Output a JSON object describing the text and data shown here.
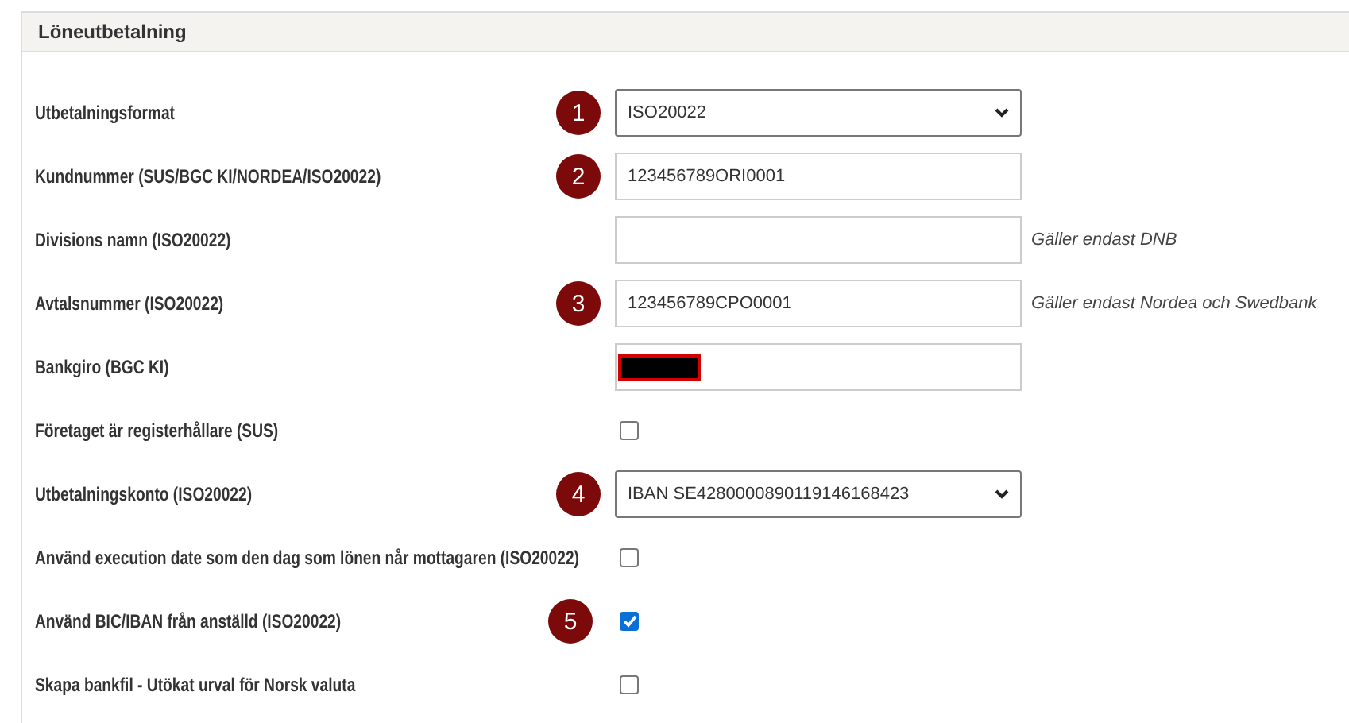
{
  "panel": {
    "title": "Löneutbetalning"
  },
  "rows": [
    {
      "kind": "select",
      "label": "Utbetalningsformat",
      "value": "ISO20022",
      "badge": "1"
    },
    {
      "kind": "text",
      "label": "Kundnummer (SUS/BGC KI/NORDEA/ISO20022)",
      "value": "123456789ORI0001",
      "badge": "2"
    },
    {
      "kind": "text",
      "label": "Divisions namn (ISO20022)",
      "hint": "Gäller endast DNB"
    },
    {
      "kind": "text",
      "label": "Avtalsnummer (ISO20022)",
      "value": "123456789CPO0001",
      "badge": "3",
      "hint": "Gäller endast Nordea och Swedbank"
    },
    {
      "kind": "text",
      "label": "Bankgiro (BGC KI)",
      "redacted": true
    },
    {
      "kind": "checkbox",
      "label": "Företaget är registerhållare (SUS)",
      "checked": false
    },
    {
      "kind": "select",
      "label": "Utbetalningskonto (ISO20022)",
      "value": "IBAN SE4280000890119146168423",
      "badge": "4"
    },
    {
      "kind": "checkbox",
      "label": "Använd execution date som den dag som lönen når mottagaren (ISO20022)",
      "checked": false
    },
    {
      "kind": "checkbox",
      "label": "Använd BIC/IBAN från anställd (ISO20022)",
      "checked": true,
      "badge": "5"
    },
    {
      "kind": "checkbox",
      "label": "Skapa bankfil - Utökat urval för Norsk valuta",
      "checked": false
    }
  ]
}
